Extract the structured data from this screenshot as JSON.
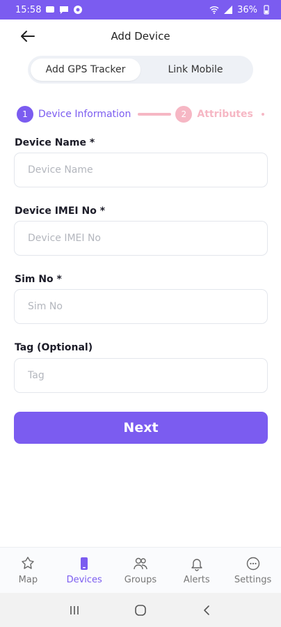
{
  "status_bar": {
    "time": "15:58",
    "battery": "36%"
  },
  "header": {
    "title": "Add Device",
    "back_icon": "arrow-left-icon"
  },
  "segmented": {
    "tabs": [
      {
        "label": "Add GPS Tracker",
        "active": true
      },
      {
        "label": "Link Mobile",
        "active": false
      }
    ]
  },
  "stepper": {
    "steps": [
      {
        "number": "1",
        "label": "Device Information",
        "active": true
      },
      {
        "number": "2",
        "label": "Attributes",
        "active": false
      }
    ]
  },
  "form": {
    "fields": [
      {
        "label": "Device Name *",
        "placeholder": "Device Name",
        "value": ""
      },
      {
        "label": "Device IMEI No *",
        "placeholder": "Device IMEI No",
        "value": ""
      },
      {
        "label": "Sim No *",
        "placeholder": "Sim No",
        "value": ""
      },
      {
        "label": "Tag (Optional)",
        "placeholder": "Tag",
        "value": ""
      }
    ],
    "submit_label": "Next"
  },
  "bottom_nav": {
    "items": [
      {
        "label": "Map",
        "icon": "map-pin-icon",
        "active": false
      },
      {
        "label": "Devices",
        "icon": "device-icon",
        "active": true
      },
      {
        "label": "Groups",
        "icon": "groups-icon",
        "active": false
      },
      {
        "label": "Alerts",
        "icon": "bell-icon",
        "active": false
      },
      {
        "label": "Settings",
        "icon": "more-icon",
        "active": false
      }
    ]
  },
  "colors": {
    "primary": "#7b5cf0",
    "step_inactive": "#f6b7c4"
  }
}
